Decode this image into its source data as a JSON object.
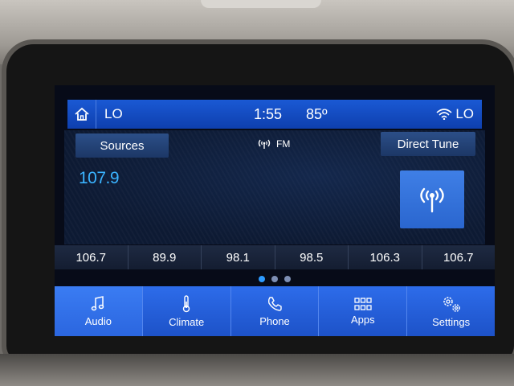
{
  "status": {
    "left_label": "LO",
    "time": "1:55",
    "temperature": "85º",
    "wifi_label": "LO"
  },
  "audio": {
    "sources_label": "Sources",
    "band": "FM",
    "direct_tune_label": "Direct Tune",
    "frequency": "107.9"
  },
  "presets": [
    "106.7",
    "89.9",
    "98.1",
    "98.5",
    "106.3",
    "106.7"
  ],
  "page_indicator": {
    "count": 3,
    "active": 0
  },
  "nav": [
    {
      "label": "Audio",
      "icon": "music-note-icon",
      "active": true
    },
    {
      "label": "Climate",
      "icon": "thermometer-icon",
      "active": false
    },
    {
      "label": "Phone",
      "icon": "phone-icon",
      "active": false
    },
    {
      "label": "Apps",
      "icon": "apps-grid-icon",
      "active": false
    },
    {
      "label": "Settings",
      "icon": "gears-icon",
      "active": false
    }
  ],
  "colors": {
    "accent_blue": "#1d52c8",
    "frequency_blue": "#3ab3ff"
  }
}
